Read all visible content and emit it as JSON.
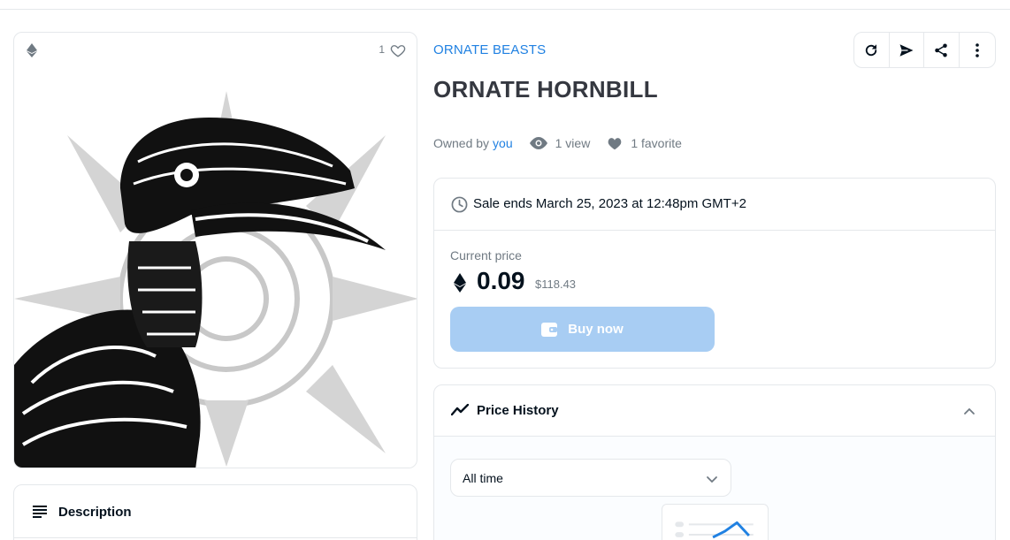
{
  "item": {
    "collection_name": "ORNATE BEASTS",
    "title": "ORNATE HORNBILL",
    "favorite_count_badge": "1",
    "owner_prefix": "Owned by",
    "owner_name": "you",
    "views": "1 view",
    "favorites": "1 favorite"
  },
  "icons": {
    "chain": "ethereum-icon",
    "actions": [
      "refresh-icon",
      "send-icon",
      "share-icon",
      "more-vertical-icon"
    ]
  },
  "sale": {
    "ends_text": "Sale ends March 25, 2023 at 12:48pm GMT+2",
    "current_price_label": "Current price",
    "price": "0.09",
    "price_usd": "$118.43",
    "buy_label": "Buy now"
  },
  "description": {
    "title": "Description"
  },
  "price_history": {
    "title": "Price History",
    "range_selected": "All time"
  },
  "colors": {
    "accent": "#2081e2",
    "buy_button_disabled": "#a8cdf3",
    "border": "#e5e8eb",
    "muted_text": "#707a83"
  }
}
